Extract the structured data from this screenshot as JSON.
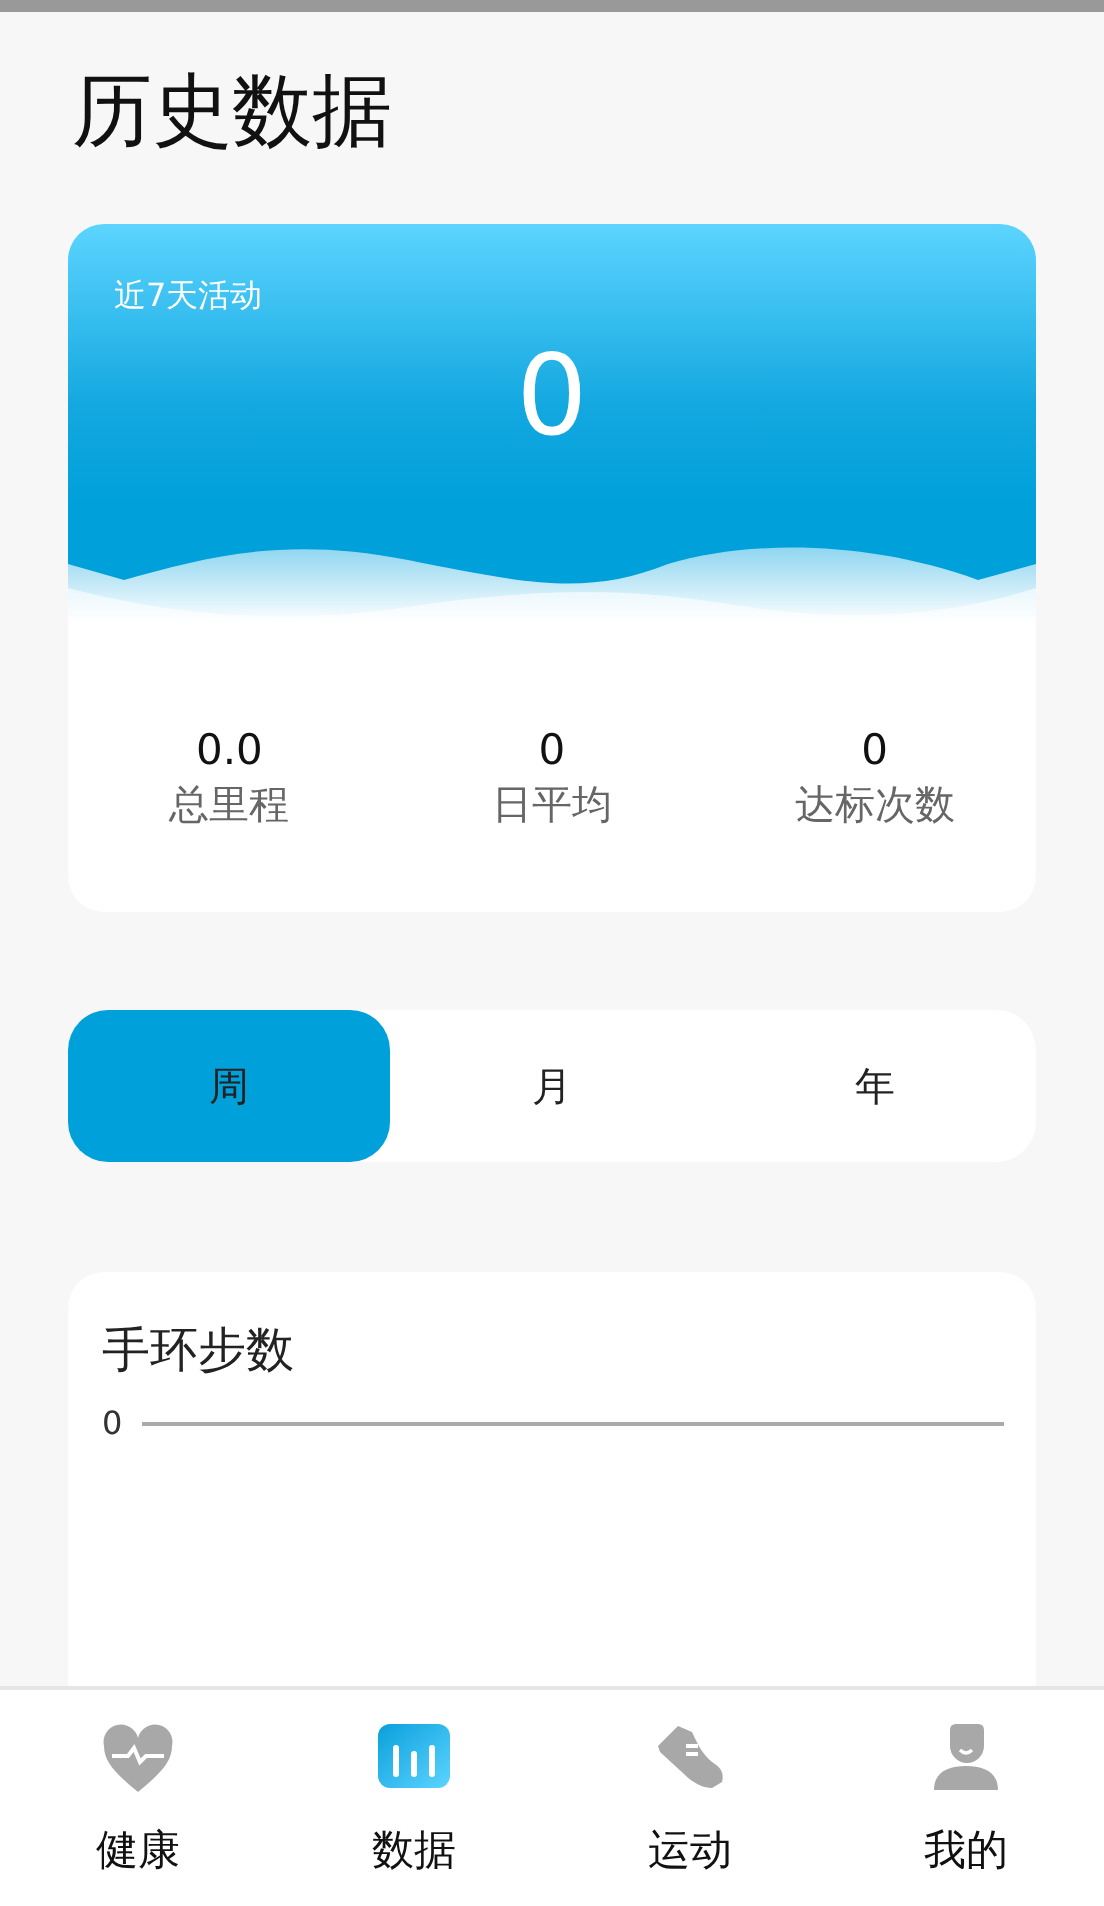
{
  "title": "历史数据",
  "summary": {
    "label": "近7天活动",
    "value": "0",
    "stats": [
      {
        "value": "0.0",
        "label": "总里程"
      },
      {
        "value": "0",
        "label": "日平均"
      },
      {
        "value": "0",
        "label": "达标次数"
      }
    ]
  },
  "period_tabs": [
    {
      "label": "周",
      "selected": true
    },
    {
      "label": "月",
      "selected": false
    },
    {
      "label": "年",
      "selected": false
    }
  ],
  "steps_card": {
    "title": "手环步数",
    "axis_label": "0"
  },
  "nav": [
    {
      "label": "健康",
      "selected": false
    },
    {
      "label": "数据",
      "selected": true
    },
    {
      "label": "运动",
      "selected": false
    },
    {
      "label": "我的",
      "selected": false
    }
  ]
}
